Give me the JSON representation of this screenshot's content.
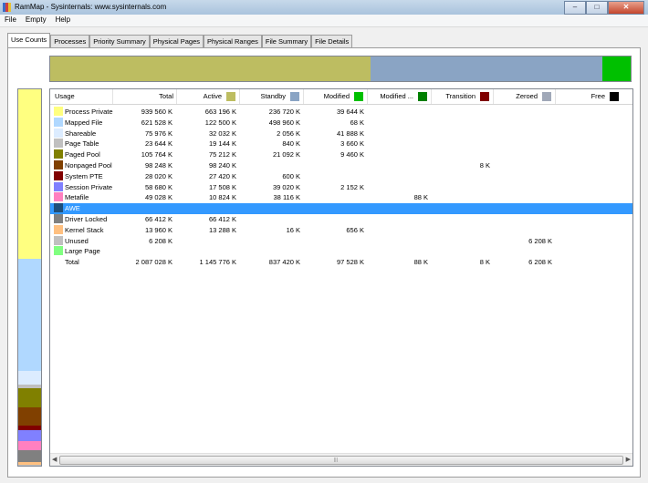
{
  "window": {
    "title": "RamMap - Sysinternals: www.sysinternals.com",
    "buttons": {
      "minimize": "–",
      "maximize": "□",
      "close": "✕"
    }
  },
  "menu": [
    "File",
    "Empty",
    "Help"
  ],
  "tabs": [
    "Use Counts",
    "Processes",
    "Priority Summary",
    "Physical Pages",
    "Physical Ranges",
    "File Summary",
    "File Details"
  ],
  "active_tab": "Use Counts",
  "top_bar": [
    {
      "name": "Active",
      "color": "#bdbd61",
      "fraction": 0.552
    },
    {
      "name": "Standby",
      "color": "#8aa4c4",
      "fraction": 0.4
    },
    {
      "name": "Modified",
      "color": "#00c000",
      "fraction": 0.048
    }
  ],
  "side_bar": [
    {
      "name": "Process Private",
      "color": "#ffff80",
      "fraction": 0.45
    },
    {
      "name": "Mapped File",
      "color": "#b0d8ff",
      "fraction": 0.298
    },
    {
      "name": "Shareable",
      "color": "#dcecff",
      "fraction": 0.036
    },
    {
      "name": "Page Table",
      "color": "#c0c0c0",
      "fraction": 0.011
    },
    {
      "name": "Paged Pool",
      "color": "#808000",
      "fraction": 0.051
    },
    {
      "name": "Nonpaged Pool",
      "color": "#804000",
      "fraction": 0.047
    },
    {
      "name": "System PTE",
      "color": "#800000",
      "fraction": 0.013
    },
    {
      "name": "Session Private",
      "color": "#8080ff",
      "fraction": 0.028
    },
    {
      "name": "Metafile",
      "color": "#ff80c0",
      "fraction": 0.024
    },
    {
      "name": "Driver Locked",
      "color": "#808080",
      "fraction": 0.032
    },
    {
      "name": "Kernel Stack",
      "color": "#ffc080",
      "fraction": 0.007
    },
    {
      "name": "Unused",
      "color": "#c0c0c0",
      "fraction": 0.003
    }
  ],
  "columns": [
    {
      "label": "Usage"
    },
    {
      "label": "Total"
    },
    {
      "label": "Active",
      "color": "#bdbd61"
    },
    {
      "label": "Standby",
      "color": "#8aa4c4"
    },
    {
      "label": "Modified",
      "color": "#00c000"
    },
    {
      "label": "Modified ...",
      "color": "#008000"
    },
    {
      "label": "Transition",
      "color": "#800000"
    },
    {
      "label": "Zeroed",
      "color": "#a0a8b8"
    },
    {
      "label": "Free",
      "color": "#000000"
    }
  ],
  "rows": [
    {
      "label": "Process Private",
      "color": "#ffff80",
      "cells": [
        "939 560 K",
        "663 196 K",
        "236 720 K",
        "39 644 K",
        "",
        "",
        "",
        ""
      ]
    },
    {
      "label": "Mapped File",
      "color": "#b0d8ff",
      "cells": [
        "621 528 K",
        "122 500 K",
        "498 960 K",
        "68 K",
        "",
        "",
        "",
        ""
      ]
    },
    {
      "label": "Shareable",
      "color": "#dcecff",
      "cells": [
        "75 976 K",
        "32 032 K",
        "2 056 K",
        "41 888 K",
        "",
        "",
        "",
        ""
      ]
    },
    {
      "label": "Page Table",
      "color": "#c0c0c0",
      "cells": [
        "23 644 K",
        "19 144 K",
        "840 K",
        "3 660 K",
        "",
        "",
        "",
        ""
      ]
    },
    {
      "label": "Paged Pool",
      "color": "#808000",
      "cells": [
        "105 764 K",
        "75 212 K",
        "21 092 K",
        "9 460 K",
        "",
        "",
        "",
        ""
      ]
    },
    {
      "label": "Nonpaged Pool",
      "color": "#804000",
      "cells": [
        "98 248 K",
        "98 240 K",
        "",
        "",
        "",
        "8 K",
        "",
        ""
      ]
    },
    {
      "label": "System PTE",
      "color": "#800000",
      "cells": [
        "28 020 K",
        "27 420 K",
        "600 K",
        "",
        "",
        "",
        "",
        ""
      ]
    },
    {
      "label": "Session Private",
      "color": "#8080ff",
      "cells": [
        "58 680 K",
        "17 508 K",
        "39 020 K",
        "2 152 K",
        "",
        "",
        "",
        ""
      ]
    },
    {
      "label": "Metafile",
      "color": "#ff80c0",
      "cells": [
        "49 028 K",
        "10 824 K",
        "38 116 K",
        "",
        "88 K",
        "",
        "",
        ""
      ]
    },
    {
      "label": "AWE",
      "color": "#1f4e79",
      "cells": [
        "",
        "",
        "",
        "",
        "",
        "",
        "",
        ""
      ],
      "selected": true
    },
    {
      "label": "Driver Locked",
      "color": "#808080",
      "cells": [
        "66 412 K",
        "66 412 K",
        "",
        "",
        "",
        "",
        "",
        ""
      ]
    },
    {
      "label": "Kernel Stack",
      "color": "#ffc080",
      "cells": [
        "13 960 K",
        "13 288 K",
        "16 K",
        "656 K",
        "",
        "",
        "",
        ""
      ]
    },
    {
      "label": "Unused",
      "color": "#c0c0c0",
      "cells": [
        "6 208 K",
        "",
        "",
        "",
        "",
        "",
        "6 208 K",
        ""
      ]
    },
    {
      "label": "Large Page",
      "color": "#80ff80",
      "cells": [
        "",
        "",
        "",
        "",
        "",
        "",
        "",
        ""
      ]
    },
    {
      "label": "Total",
      "color": "",
      "cells": [
        "2 087 028 K",
        "1 145 776 K",
        "837 420 K",
        "97 528 K",
        "88 K",
        "8 K",
        "6 208 K",
        ""
      ]
    }
  ],
  "scrollbar": {
    "left_arrow": "◀",
    "right_arrow": "▶",
    "grip": "|||"
  }
}
